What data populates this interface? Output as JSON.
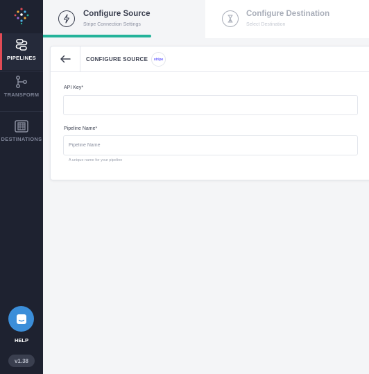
{
  "sidebar": {
    "items": [
      {
        "label": "PIPELINES",
        "icon": "pipelines-icon"
      },
      {
        "label": "TRANSFORM",
        "icon": "transform-icon"
      },
      {
        "label": "DESTINATIONS",
        "icon": "destinations-icon"
      }
    ],
    "help_label": "HELP",
    "version": "v1.38"
  },
  "stepper": {
    "steps": [
      {
        "title": "Configure Source",
        "subtitle": "Stripe Connection Settings",
        "icon": "lightning-icon",
        "state": "active"
      },
      {
        "title": "Configure Destination",
        "subtitle": "Select Destination",
        "icon": "hourglass-icon",
        "state": "inactive"
      }
    ]
  },
  "card": {
    "title": "CONFIGURE SOURCE",
    "badge": "stripe",
    "fields": {
      "api_key": {
        "label": "API Key*",
        "value": "",
        "placeholder": ""
      },
      "pipeline_name": {
        "label": "Pipeline Name*",
        "value": "",
        "placeholder": "Pipeline Name",
        "hint": "A unique name for your pipeline"
      }
    }
  },
  "colors": {
    "sidebar_bg": "#1e2230",
    "accent_red": "#e14b55",
    "progress_teal": "#24b39a",
    "help_blue": "#3b8ed9"
  }
}
